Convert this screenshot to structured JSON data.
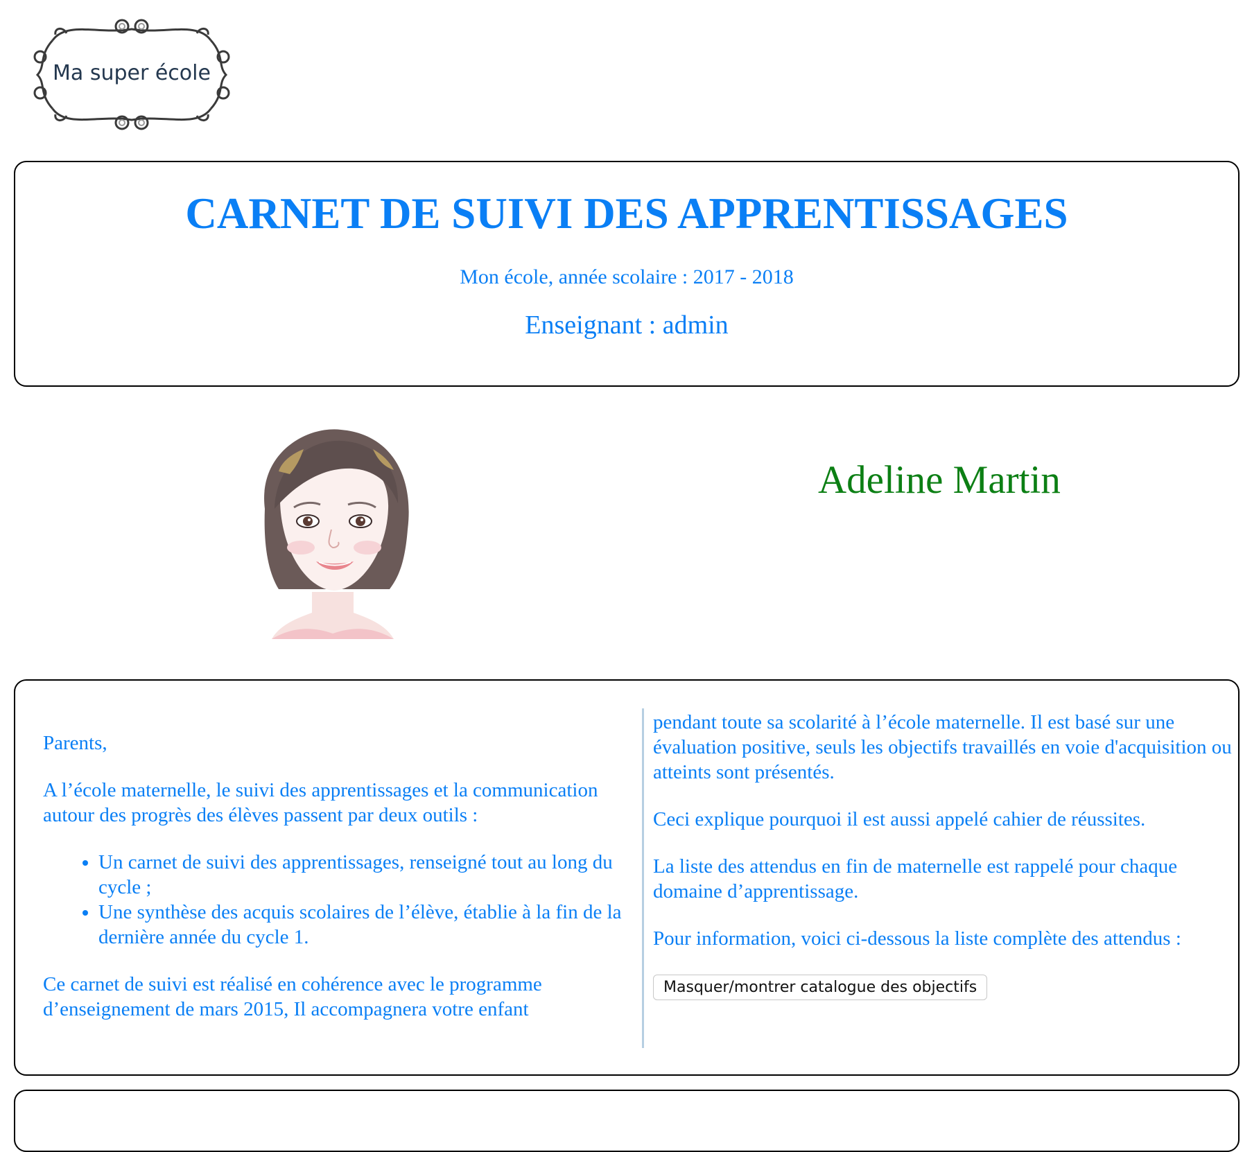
{
  "logo": {
    "text": "Ma super école"
  },
  "header": {
    "title": "CARNET DE SUIVI DES APPRENTISSAGES",
    "subtitle": "Mon école, année scolaire : 2017 - 2018",
    "teacher": "Enseignant : admin"
  },
  "student": {
    "name": "Adeline Martin"
  },
  "intro": {
    "greeting": "Parents,",
    "paragraph1": "A l’école maternelle, le suivi des apprentissages et la communication autour des progrès des élèves passent par deux outils :",
    "bullets": [
      "Un carnet de suivi des apprentissages, renseigné tout au long du cycle ;",
      "Une synthèse des acquis scolaires de l’élève, établie à la fin de la dernière année du cycle 1."
    ],
    "paragraph2_left": "Ce carnet de suivi est réalisé en cohérence avec le programme d’enseignement de mars 2015, Il accompagnera votre enfant",
    "paragraph2_right": "pendant toute sa scolarité à l’école maternelle. Il est basé sur une évaluation positive, seuls les objectifs travaillés en voie d'acquisition ou atteints sont présentés.",
    "paragraph3": "Ceci explique pourquoi il est aussi appelé cahier de réussites.",
    "paragraph4": "La liste des attendus en fin de maternelle est rappelé pour chaque domaine d’apprentissage.",
    "paragraph5": "Pour information, voici ci-dessous la liste complète des attendus :",
    "toggle_button": "Masquer/montrer catalogue des objectifs"
  },
  "colors": {
    "accent": "#0a7ff5",
    "name": "#0c7f14"
  }
}
